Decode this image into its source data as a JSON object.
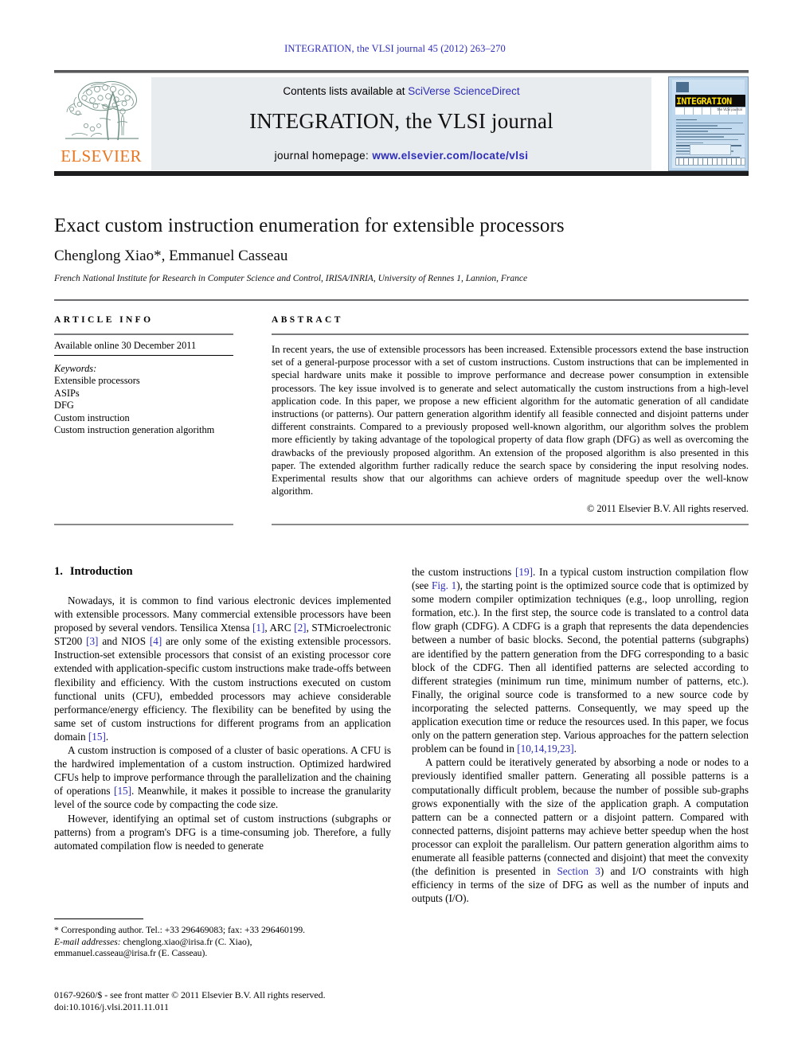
{
  "running_head": "INTEGRATION, the VLSI journal 45 (2012) 263–270",
  "masthead": {
    "contents_prefix": "Contents lists available at ",
    "contents_link": "SciVerse ScienceDirect",
    "journal_name": "INTEGRATION, the VLSI journal",
    "homepage_prefix": "journal homepage: ",
    "homepage_url": "www.elsevier.com/locate/vlsi",
    "publisher": "ELSEVIER",
    "cover_banner": "INTEGRATION",
    "cover_sub": "the VLSI journal"
  },
  "article": {
    "title": "Exact custom instruction enumeration for extensible processors",
    "authors": "Chenglong Xiao*, Emmanuel Casseau",
    "affiliation": "French National Institute for Research in Computer Science and Control, IRISA/INRIA, University of Rennes 1, Lannion, France"
  },
  "info": {
    "heading": "ARTICLE INFO",
    "available_online": "Available online 30 December 2011",
    "keywords_label": "Keywords:",
    "keywords": [
      "Extensible processors",
      "ASIPs",
      "DFG",
      "Custom instruction",
      "Custom instruction generation algorithm"
    ]
  },
  "abstract": {
    "heading": "ABSTRACT",
    "text": "In recent years, the use of extensible processors has been increased. Extensible processors extend the base instruction set of a general-purpose processor with a set of custom instructions. Custom instructions that can be implemented in special hardware units make it possible to improve performance and decrease power consumption in extensible processors. The key issue involved is to generate and select automatically the custom instructions from a high-level application code. In this paper, we propose a new efficient algorithm for the automatic generation of all candidate instructions (or patterns). Our pattern generation algorithm identify all feasible connected and disjoint patterns under different constraints. Compared to a previously proposed well-known algorithm, our algorithm solves the problem more efficiently by taking advantage of the topological property of data flow graph (DFG) as well as overcoming the drawbacks of the previously proposed algorithm. An extension of the proposed algorithm is also presented in this paper. The extended algorithm further radically reduce the search space by considering the input resolving nodes. Experimental results show that our algorithms can achieve orders of magnitude speedup over the well-know algorithm.",
    "copyright": "© 2011 Elsevier B.V. All rights reserved."
  },
  "introduction": {
    "number": "1.",
    "heading": "Introduction",
    "left_paragraphs": [
      "Nowadays, it is common to find various electronic devices implemented with extensible processors. Many commercial extensible processors have been proposed by several vendors. Tensilica Xtensa [1], ARC [2], STMicroelectronic ST200 [3] and NIOS [4] are only some of the existing extensible processors. Instruction-set extensible processors that consist of an existing processor core extended with application-specific custom instructions make trade-offs between flexibility and efficiency. With the custom instructions executed on custom functional units (CFU), embedded processors may achieve considerable performance/energy efficiency. The flexibility can be benefited by using the same set of custom instructions for different programs from an application domain [15].",
      "A custom instruction is composed of a cluster of basic operations. A CFU is the hardwired implementation of a custom instruction. Optimized hardwired CFUs help to improve performance through the parallelization and the chaining of operations [15]. Meanwhile, it makes it possible to increase the granularity level of the source code by compacting the code size.",
      "However, identifying an optimal set of custom instructions (subgraphs or patterns) from a program's DFG is a time-consuming job. Therefore, a fully automated compilation flow is needed to generate"
    ],
    "right_paragraphs": [
      "the custom instructions [19]. In a typical custom instruction compilation flow (see Fig. 1), the starting point is the optimized source code that is optimized by some modern compiler optimization techniques (e.g., loop unrolling, region formation, etc.). In the first step, the source code is translated to a control data flow graph (CDFG). A CDFG is a graph that represents the data dependencies between a number of basic blocks. Second, the potential patterns (subgraphs) are identified by the pattern generation from the DFG corresponding to a basic block of the CDFG. Then all identified patterns are selected according to different strategies (minimum run time, minimum number of patterns, etc.). Finally, the original source code is transformed to a new source code by incorporating the selected patterns. Consequently, we may speed up the application execution time or reduce the resources used. In this paper, we focus only on the pattern generation step. Various approaches for the pattern selection problem can be found in [10,14,19,23].",
      "A pattern could be iteratively generated by absorbing a node or nodes to a previously identified smaller pattern. Generating all possible patterns is a computationally difficult problem, because the number of possible sub-graphs grows exponentially with the size of the application graph. A computation pattern can be a connected pattern or a disjoint pattern. Compared with connected patterns, disjoint patterns may achieve better speedup when the host processor can exploit the parallelism. Our pattern generation algorithm aims to enumerate all feasible patterns (connected and disjoint) that meet the convexity (the definition is presented in Section 3) and I/O constraints with high efficiency in terms of the size of DFG as well as the number of inputs and outputs (I/O)."
    ]
  },
  "footnote": {
    "corresponding": "* Corresponding author. Tel.: +33 296469083; fax: +33 296460199.",
    "email_label": "E-mail addresses:",
    "email_line1": " chenglong.xiao@irisa.fr (C. Xiao),",
    "email_line2": "emmanuel.casseau@irisa.fr (E. Casseau)."
  },
  "imprint": {
    "line1": "0167-9260/$ - see front matter © 2011 Elsevier B.V. All rights reserved.",
    "line2": "doi:10.1016/j.vlsi.2011.11.011"
  },
  "colors": {
    "link": "#2d2dbb",
    "elsevier_orange": "#e87722",
    "panel_grey": "#e9ecee"
  }
}
